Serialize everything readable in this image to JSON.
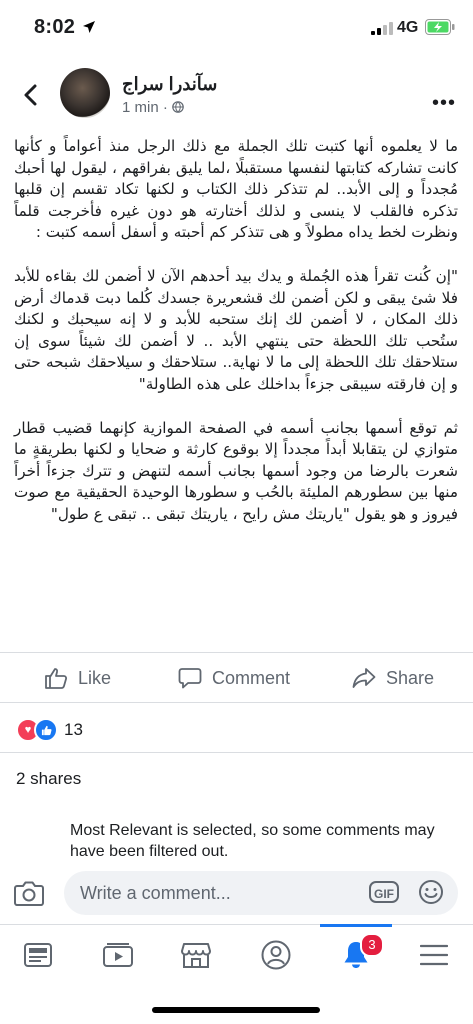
{
  "status_bar": {
    "time": "8:02",
    "network": "4G"
  },
  "post_header": {
    "author": "سآندرا سراج",
    "time": "1 min",
    "more_icon": "more-dots-icon"
  },
  "post": {
    "paragraphs": [
      "ما لا يعلموه أنها كتبت تلك الجملة مع ذلك الرجل منذ أعواماً و كأنها كانت تشاركه كتابتها لنفسها مستقبلًا ،لما يليق بفراقهم ، ليقول لها أحبك مُجدداً و إلى الأبد.. لم تتذكر ذلك الكتاب و لكنها تكاد تقسم إن قلبها تذكره فالقلب لا ينسى و لذلك أختارته هو دون غيره فأخرجت قلماً ونظرت لخط يداه مطولاً و هى تتذكر كم أحبته و أسفل أسمه كتبت :",
      "\"إن كُنت تقرأ هذه الجُملة و يدك بيد أحدهم الآن لا أضمن لك بقاءه للأبد فلا شئ يبقى و لكن أضمن لك قشعريرة جسدك كُلما دبت قدماك أرض ذلك المكان ، لا أضمن لك إنك ستحبه للأبد و لا إنه سيحبك و لكنك ستُحب تلك اللحظة حتى ينتهي الأبد .. لا أضمن لك شيئاً سوى إن ستلاحقك تلك اللحظة إلى ما لا نهاية.. ستلاحقك و سيلاحقك شبحه حتى و إن فارقته سيبقى جزءاً بداخلك على هذه الطاولة\"",
      "ثم توقع أسمها بجانب أسمه في الصفحة الموازية كإنهما قضيب قطار متوازي لن يتقابلا أبداً مجدداً إلا بوقوع كارثة و ضحايا و لكنها بطريقةٍ ما شعرت بالرضا من وجود أسمها بجانب أسمه لتنهض و تترك جزءاً أخراً منها بين سطورهم المليئة بالحُب و سطورها الوحيدة الحقيقية مع صوت فيروز و هو يقول \"ياريتك مش رايح ، ياريتك تبقى .. تبقى ع طول\""
    ]
  },
  "actions": {
    "like": "Like",
    "comment": "Comment",
    "share": "Share"
  },
  "reactions": {
    "count": "13",
    "types": [
      "heart-icon",
      "thumbs-up-icon"
    ]
  },
  "shares": "2 shares",
  "filter_notice": "Most Relevant is selected, so some comments may have been filtered out.",
  "composer": {
    "placeholder": "Write a comment...",
    "gif_label": "GIF"
  },
  "tabbar": {
    "notifications_badge": "3",
    "active_tab": "notifications"
  },
  "colors": {
    "accent": "#1877f2",
    "badge": "#e41e3f",
    "heart": "#f33e58",
    "battery": "#4cd964"
  }
}
